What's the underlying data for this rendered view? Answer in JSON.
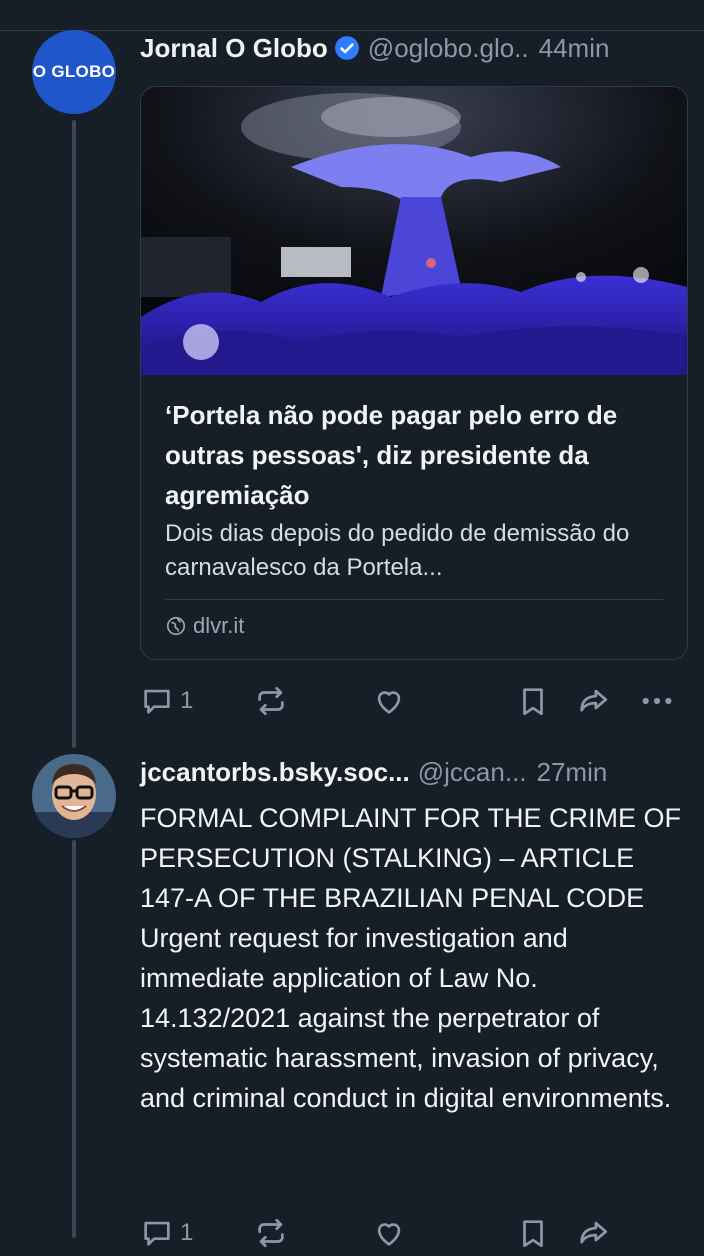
{
  "post1": {
    "avatar_text": "O GLOBO",
    "display_name": "Jornal O Globo",
    "handle": "@oglobo.glo..",
    "time": "44min",
    "embed": {
      "title": "‘Portela não pode pagar pelo erro de outras pessoas', diz presidente da agremiação",
      "description": "Dois dias depois do pedido de demissão do carnavalesco da Portela...",
      "source": "dlvr.it"
    },
    "actions": {
      "reply_count": "1"
    }
  },
  "post2": {
    "display_name": "jccantorbs.bsky.soc...",
    "handle": "@jccan...",
    "time": "27min",
    "text": "FORMAL COMPLAINT FOR THE CRIME OF PERSECUTION (STALKING) – ARTICLE 147-A OF THE BRAZILIAN PENAL CODE\nUrgent request for investigation and immediate application of Law No. 14.132/2021 against the perpetrator of systematic harassment, invasion of privacy, and criminal conduct in digital environments.",
    "actions": {
      "reply_count": "1"
    }
  },
  "colors": {
    "background": "#161e27",
    "accent": "#1f56c9",
    "verified": "#2f7dff",
    "muted": "#8b98a8"
  }
}
